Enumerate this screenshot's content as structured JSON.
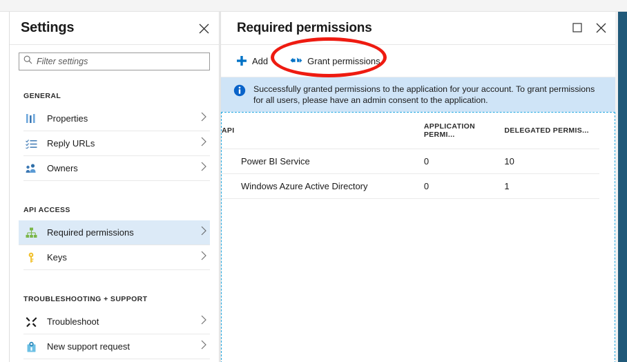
{
  "settings_blade": {
    "title": "Settings",
    "close_icon": "close-icon",
    "filter": {
      "placeholder": "Filter settings",
      "value": "",
      "icon": "search-icon"
    },
    "groups": [
      {
        "header": "GENERAL",
        "items": [
          {
            "label": "Properties",
            "icon": "properties-icon",
            "selected": false
          },
          {
            "label": "Reply URLs",
            "icon": "list-icon",
            "selected": false
          },
          {
            "label": "Owners",
            "icon": "owners-icon",
            "selected": false
          }
        ]
      },
      {
        "header": "API ACCESS",
        "items": [
          {
            "label": "Required permissions",
            "icon": "hierarchy-icon",
            "selected": true
          },
          {
            "label": "Keys",
            "icon": "key-icon",
            "selected": false
          }
        ]
      },
      {
        "header": "TROUBLESHOOTING + SUPPORT",
        "items": [
          {
            "label": "Troubleshoot",
            "icon": "wrench-screwdriver-icon",
            "selected": false
          },
          {
            "label": "New support request",
            "icon": "support-icon",
            "selected": false
          }
        ]
      }
    ]
  },
  "permissions_blade": {
    "title": "Required permissions",
    "maximize_icon": "maximize-icon",
    "close_icon": "close-icon",
    "toolbar": {
      "add_label": "Add",
      "add_icon": "plus-icon",
      "grant_label": "Grant permissions",
      "grant_icon": "grant-permissions-icon"
    },
    "info_bar": {
      "icon": "info-icon",
      "text": "Successfully granted permissions to the application for your account. To grant permissions for all users, please have an admin consent to the application."
    },
    "table": {
      "columns": [
        "API",
        "APPLICATION PERMI...",
        "DELEGATED PERMIS..."
      ],
      "rows": [
        {
          "api": "Power BI Service",
          "application_permissions": "0",
          "delegated_permissions": "10"
        },
        {
          "api": "Windows Azure Active Directory",
          "application_permissions": "0",
          "delegated_permissions": "1"
        }
      ]
    }
  },
  "annotation": {
    "shape": "ellipse",
    "color": "#ee1b11",
    "targets": "Grant permissions"
  },
  "colors": {
    "accent_blue": "#0078d4",
    "info_bar_bg": "#cfe4f7",
    "selected_row_bg": "#dceaf7",
    "right_rail": "#205979",
    "dashed_border": "#1ea7e1",
    "annotation_red": "#ee1b11"
  }
}
